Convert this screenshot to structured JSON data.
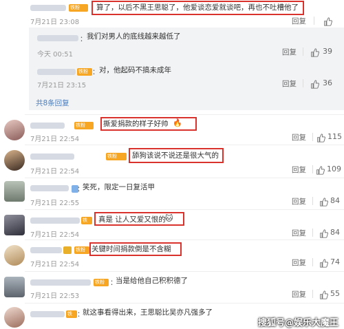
{
  "comments_top": {
    "text": "算了，以后不黑王思聪了，他爱谈恋爱就谈吧，再也不吐槽他了",
    "time": "7月21日 23:08",
    "reply": "回复"
  },
  "sub_replies": [
    {
      "text": "我们对男人的底线越来越低了",
      "time": "今天 00:51",
      "reply": "回复",
      "likes": "39"
    },
    {
      "text": "对，他起码不搞未成年",
      "time": "7月21日 23:15",
      "reply": "回复",
      "likes": "36"
    }
  ],
  "more_replies": "共8条回复",
  "badge_label": "铁粉",
  "comments": [
    {
      "text": "撕爱捐款的样子好帅",
      "emoji": "🔥",
      "time": "7月21日 22:54",
      "reply": "回复",
      "likes": "115"
    },
    {
      "text": "舔狗该说不说还是很大气的",
      "time": "7月21日 22:54",
      "reply": "回复",
      "likes": "109"
    },
    {
      "text": "笑死，限定一日复活甲",
      "time": "7月21日 22:55",
      "reply": "回复",
      "likes": "84"
    },
    {
      "text": "真是 让人又爱又恨的",
      "emoji": "🐱",
      "time": "7月21日 22:54",
      "reply": "回复",
      "likes": "84"
    },
    {
      "text": "关键时间捐款倒是不含糊",
      "time": "7月21日 22:54",
      "reply": "回复",
      "likes": "74"
    },
    {
      "text": "当是给他自己积积德了",
      "time": "7月21日 22:53",
      "reply": "回复",
      "likes": "55"
    },
    {
      "text": "就这事看得出来，王思聪比吴亦凡强多了",
      "time": "",
      "reply": "",
      "likes": ""
    }
  ],
  "watermark": "搜狐号@娱乐大魔王",
  "colors": {
    "highlight": "#d9312b",
    "badge": "#f6a623",
    "link": "#4a7ec0",
    "meta": "#999999"
  },
  "icons": {
    "like": "thumbs-up-icon",
    "avatar": "user-avatar"
  }
}
